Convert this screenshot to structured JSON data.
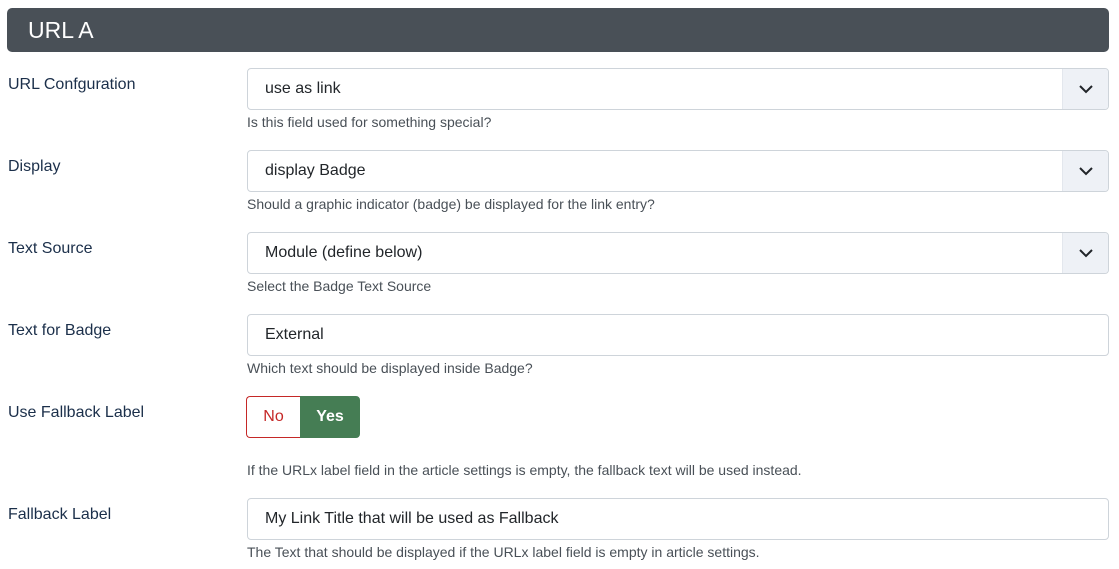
{
  "section": {
    "title": "URL A"
  },
  "fields": {
    "url_configuration": {
      "label": "URL Confguration",
      "value": "use as link",
      "help": "Is this field used for something special?"
    },
    "display": {
      "label": "Display",
      "value": "display Badge",
      "help": "Should a graphic indicator (badge) be displayed for the link entry?"
    },
    "text_source": {
      "label": "Text Source",
      "value": "Module (define below)",
      "help": "Select the Badge Text Source"
    },
    "text_for_badge": {
      "label": "Text for Badge",
      "value": "External",
      "help": "Which text should be displayed inside Badge?"
    },
    "use_fallback_label": {
      "label": "Use Fallback Label",
      "no_label": "No",
      "yes_label": "Yes",
      "selected": "Yes",
      "help": "If the URLx label field in the article settings is empty, the fallback text will be used instead."
    },
    "fallback_label": {
      "label": "Fallback Label",
      "value": "My Link Title that will be used as Fallback",
      "help": "The Text that should be displayed if the URLx label field is empty in article settings."
    }
  },
  "colors": {
    "header_bg": "#495057",
    "toggle_yes_bg": "#457d54",
    "toggle_no_border": "#c52827",
    "label_text": "#1b2f4a"
  },
  "icons": {
    "select_caret": "chevron-down-icon"
  }
}
